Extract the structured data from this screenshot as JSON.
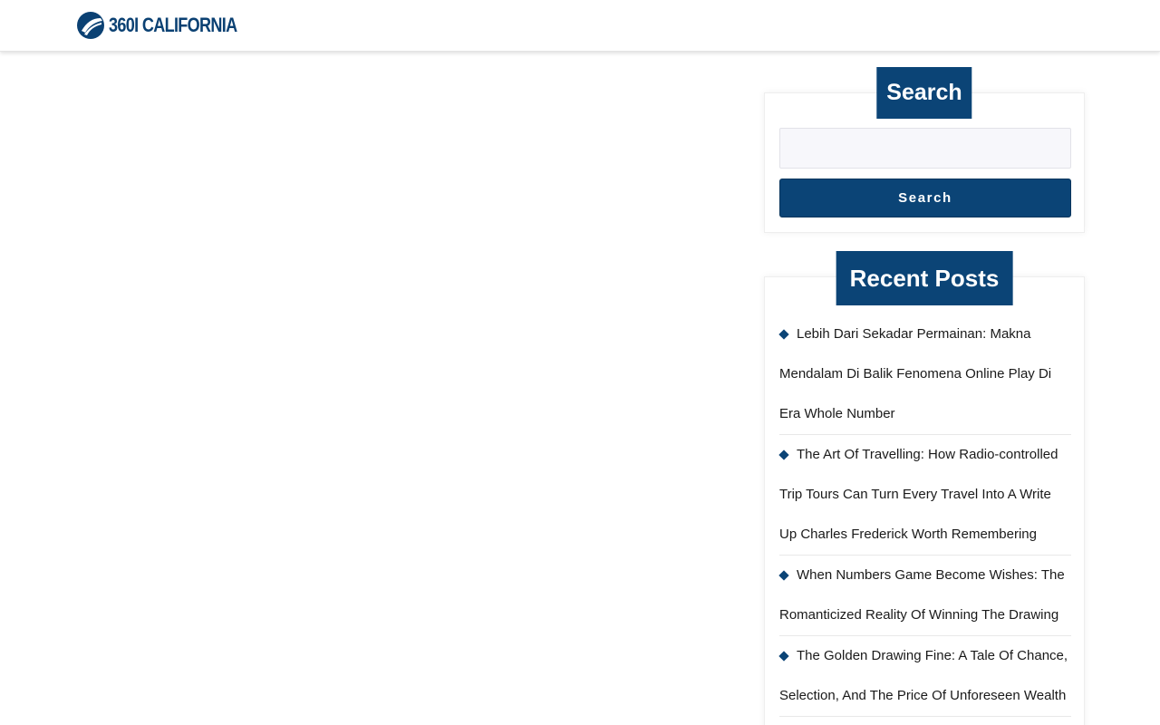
{
  "header": {
    "logo_text": "360I CALIFORNIA",
    "logo_icon": "circle-swoosh-logo-icon"
  },
  "colors": {
    "brand": "#0b4476",
    "logo": "#0b4173"
  },
  "sidebar": {
    "search": {
      "title": "Search",
      "placeholder": "",
      "value": "",
      "button_label": "Search"
    },
    "recent_posts": {
      "title": "Recent Posts",
      "bullet_icon": "diamond-bullet-icon",
      "items": [
        {
          "title": "Lebih Dari Sekadar Permainan: Makna Mendalam Di Balik Fenomena Online Play Di Era Whole Number"
        },
        {
          "title": "The Art Of Travelling: How Radio-controlled Trip Tours Can Turn Every Travel Into A Write Up Charles Frederick Worth Remembering"
        },
        {
          "title": "When Numbers Game Become Wishes: The Romanticized Reality Of Winning The Drawing"
        },
        {
          "title": "The Golden Drawing Fine: A Tale Of Chance, Selection, And The Price Of Unforeseen Wealth"
        }
      ]
    }
  }
}
